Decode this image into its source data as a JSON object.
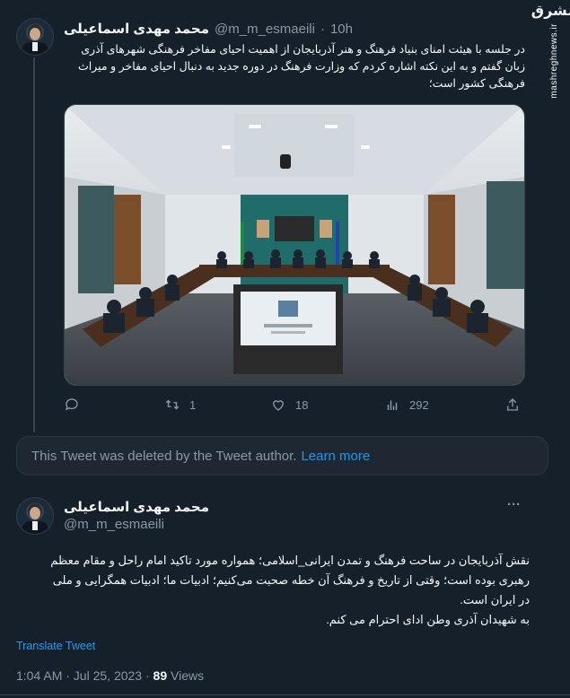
{
  "tweet1": {
    "name": "محمد مهدی اسماعیلی",
    "handle": "@m_m_esmaeili",
    "time": "10h",
    "text": "در جلسه با هیئت امنای بنیاد فرهنگ و هنر آذربایجان از اهمیت احیای مفاخر فرهنگی شهرهای آذری زبان گفتم و به این نکته اشاره کردم که وزارت فرهنگ در دوره جدید به دنبال احیای مفاخر و میراث فرهنگی کشور است؛",
    "actions": {
      "reply_icon": "reply-icon",
      "retweet_count": "1",
      "like_count": "18",
      "views_count": "292"
    }
  },
  "deleted": {
    "text": "This Tweet was deleted by the Tweet author.",
    "link": "Learn more"
  },
  "tweet2": {
    "name": "محمد مهدی اسماعیلی",
    "handle": "@m_m_esmaeili",
    "more": "···",
    "text_line1": "نقش آذربایجان در ساحت فرهنگ و تمدن ایرانی_اسلامی؛ همواره مورد تاکید امام راحل و مقام معظم",
    "text_line2": "رهبری بوده است؛ وقتی از تاریخ و فرهنگ آن خطه صحبت می‌کنیم؛ ادبیات ما؛ ادبیات همگرایی و ملی",
    "text_line3": "در ایران است.",
    "text_line4": "به شهیدان آذری وطن ادای احترام می کنم.",
    "translate": "Translate Tweet",
    "timestamp": "1:04 AM · Jul 25, 2023 · ",
    "views_count": "89",
    "views_label": " Views"
  },
  "watermark": {
    "logo": "مشرق",
    "site": "mashreghnews.ir"
  },
  "colors": {
    "background": "#15202b",
    "text": "#f7f9f9",
    "muted": "#8b98a5",
    "link": "#1d9bf0",
    "border": "#38444d"
  }
}
